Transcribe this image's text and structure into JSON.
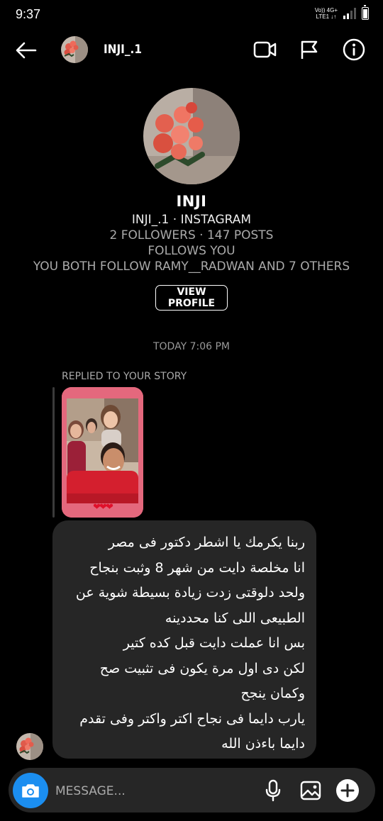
{
  "status_bar": {
    "time": "9:37",
    "network_top": "Vo)) 4G+",
    "network_bottom": "LTE1 ↓↑"
  },
  "header": {
    "username": "INJI_.1"
  },
  "icons": {
    "back": "arrow-left-icon",
    "video": "video-camera-icon",
    "flag": "flag-icon",
    "info": "info-icon",
    "camera": "camera-icon",
    "mic": "microphone-icon",
    "gallery": "image-icon",
    "add": "plus-icon"
  },
  "profile": {
    "name": "INJI",
    "handle_line": "INJI_.1 · INSTAGRAM",
    "stats": "2 FOLLOWERS · 147 POSTS",
    "follows": "FOLLOWS YOU",
    "mutual": "YOU BOTH FOLLOW RAMY__RADWAN AND 7 OTHERS",
    "view_profile_label": "VIEW PROFILE"
  },
  "thread": {
    "timestamp": "TODAY 7:06 PM",
    "replied_label": "REPLIED TO YOUR STORY",
    "story_hearts": "❤❤❤",
    "message_lines": [
      "ربنا يكرمك يا اشطر دكتور فى مصر",
      "انا مخلصة دايت من شهر 8 وثبت بنجاح",
      "ولحد دلوقتى زدت زيادة بسيطة شوية عن",
      "الطبيعى اللى كنا محددينه",
      "بس انا عملت دايت قبل كده كتير",
      "لكن دى اول مرة يكون فى تثبيت صح",
      "وكمان ينجح",
      "يارب دايما فى نجاح اكتر واكتر وفى تقدم",
      "دايما باءذن الله"
    ]
  },
  "composer": {
    "placeholder": "MESSAGE..."
  },
  "colors": {
    "background": "#000000",
    "bubble": "#262626",
    "accent": "#1b8ef0",
    "heart": "#e0102a"
  }
}
